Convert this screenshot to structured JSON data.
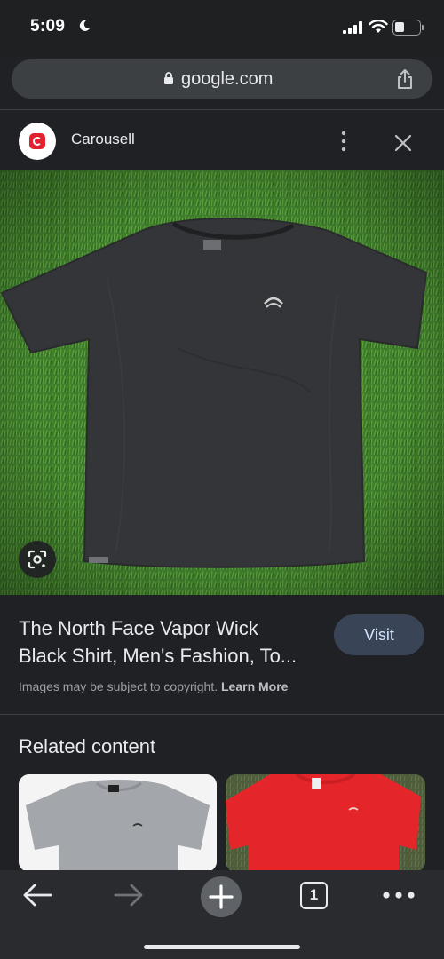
{
  "status_bar": {
    "time": "5:09",
    "battery_level": "5",
    "icons": [
      "moon-icon",
      "signal-icon",
      "wifi-icon",
      "battery-icon"
    ]
  },
  "url_bar": {
    "url": "google.com",
    "icons": [
      "lock-icon",
      "share-icon"
    ]
  },
  "source": {
    "name": "Carousell",
    "brand_color": "#e3202e",
    "icons": [
      "carousell-logo-icon",
      "more-vertical-icon",
      "close-icon"
    ]
  },
  "result": {
    "title_line1": "The North Face Vapor Wick",
    "title_line2": "Black Shirt, Men's Fashion, To...",
    "visit_label": "Visit",
    "copyright_text": "Images may be subject to copyright.",
    "learn_more_label": "Learn More",
    "lens_icon": "google-lens-icon"
  },
  "related": {
    "heading": "Related content"
  },
  "toolbar": {
    "tab_count": "1",
    "icons": [
      "back-arrow-icon",
      "forward-arrow-icon",
      "plus-icon",
      "tabs-icon",
      "more-horizontal-icon"
    ]
  },
  "colors": {
    "background": "#202124",
    "visit_button": "#394457",
    "accent_text": "#d2e3fc"
  }
}
